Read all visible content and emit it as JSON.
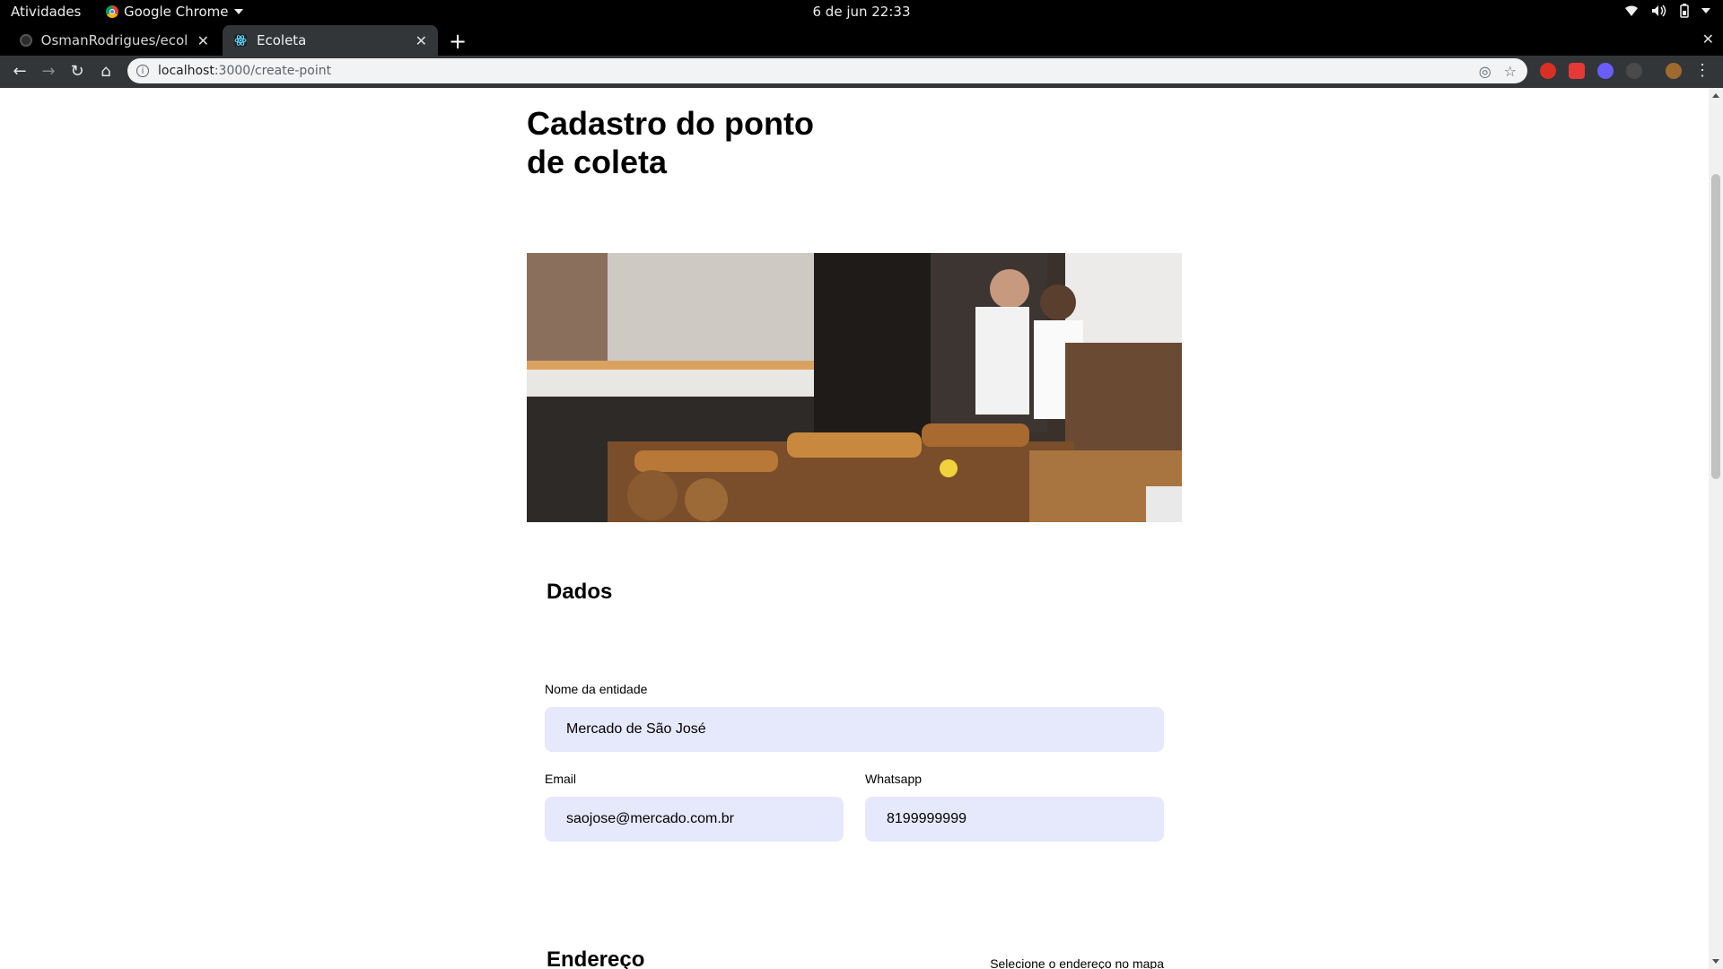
{
  "system_bar": {
    "activities": "Atividades",
    "app_name": "Google Chrome",
    "clock": "6 de jun  22:33"
  },
  "browser": {
    "tabs": [
      {
        "title": "OsmanRodrigues/ecoleta",
        "active": false
      },
      {
        "title": "Ecoleta",
        "active": true
      }
    ],
    "address": {
      "host": "localhost",
      "path": ":3000/create-point"
    }
  },
  "page": {
    "title": "Cadastro do ponto de coleta",
    "hero_image_alt": "bakery photo",
    "sections": {
      "dados": "Dados",
      "endereco": "Endereço",
      "map_hint": "Selecione o endereço no mapa"
    },
    "form": {
      "name_label": "Nome da entidade",
      "name_value": "Mercado de São José",
      "email_label": "Email",
      "email_value": "saojose@mercado.com.br",
      "whatsapp_label": "Whatsapp",
      "whatsapp_value": "8199999999"
    }
  },
  "colors": {
    "input_bg": "#e6e8fc",
    "chrome_toolbar": "#333639"
  }
}
